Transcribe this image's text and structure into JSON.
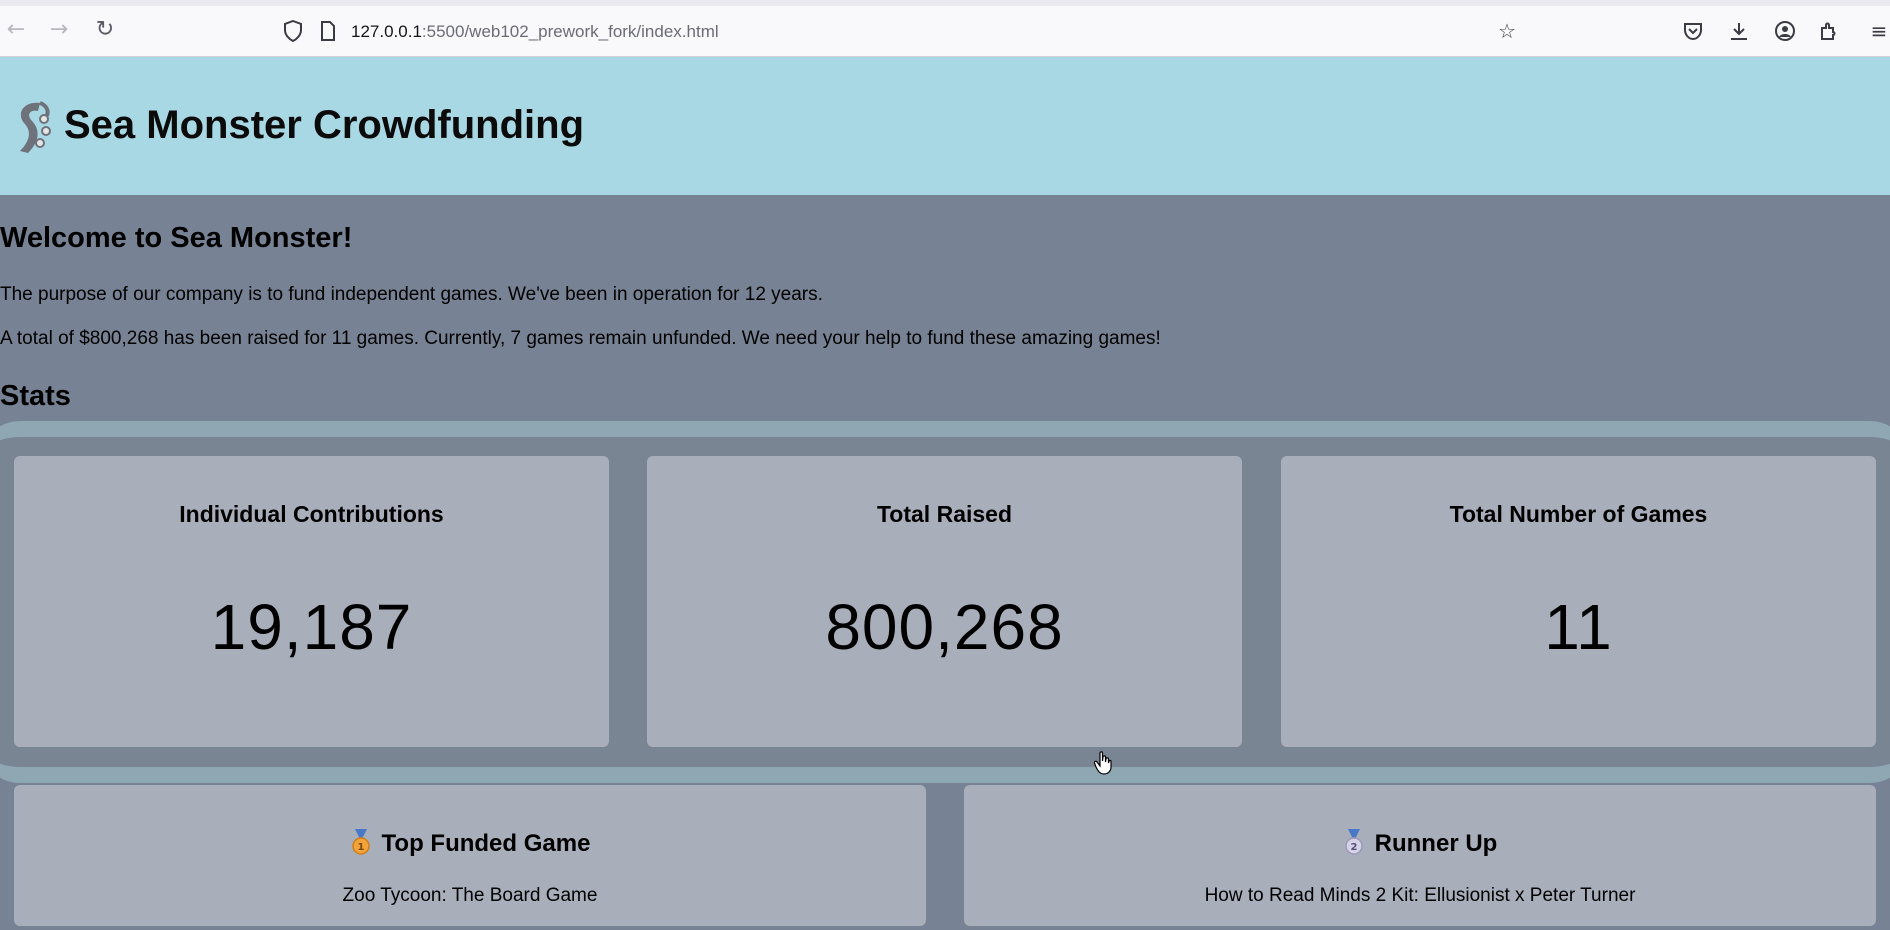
{
  "browser": {
    "url_host": "127.0.0.1",
    "url_path": ":5500/web102_prework_fork/index.html",
    "back_icon": "arrow-left-icon",
    "forward_icon": "arrow-right-icon",
    "reload_icon": "reload-icon"
  },
  "header": {
    "title": "Sea Monster Crowdfunding",
    "logo_icon": "tentacle-logo-icon",
    "background": "#a8d8e4"
  },
  "intro": {
    "heading": "Welcome to Sea Monster!",
    "paragraph_1": "The purpose of our company is to fund independent games. We've been in operation for 12 years.",
    "paragraph_2": "A total of $800,268 has been raised for 11 games. Currently, 7 games remain unfunded. We need your help to fund these amazing games!"
  },
  "stats": {
    "heading": "Stats",
    "cards": [
      {
        "label": "Individual Contributions",
        "value": "19,187"
      },
      {
        "label": "Total Raised",
        "value": "800,268"
      },
      {
        "label": "Total Number of Games",
        "value": "11"
      }
    ]
  },
  "highlights": {
    "top": {
      "heading": "Top Funded Game",
      "game": "Zoo Tycoon: The Board Game",
      "icon": "gold-medal-icon"
    },
    "runner_up": {
      "heading": "Runner Up",
      "game": "How to Read Minds 2 Kit: Ellusionist x Peter Turner",
      "icon": "silver-medal-icon"
    }
  },
  "colors": {
    "page_background": "#778394",
    "card_background": "#a8afbb",
    "band_border": "#8fa6b3"
  }
}
